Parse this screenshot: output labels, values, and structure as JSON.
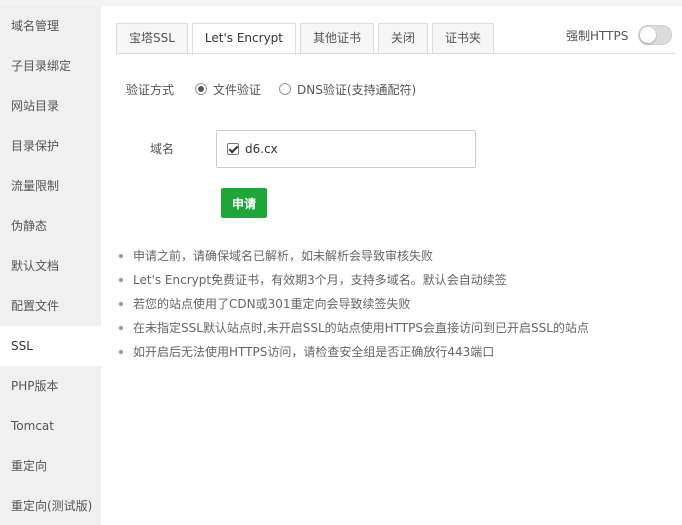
{
  "sidebar": {
    "items": [
      {
        "label": "域名管理"
      },
      {
        "label": "子目录绑定"
      },
      {
        "label": "网站目录"
      },
      {
        "label": "目录保护"
      },
      {
        "label": "流量限制"
      },
      {
        "label": "伪静态"
      },
      {
        "label": "默认文档"
      },
      {
        "label": "配置文件"
      },
      {
        "label": "SSL"
      },
      {
        "label": "PHP版本"
      },
      {
        "label": "Tomcat"
      },
      {
        "label": "重定向"
      },
      {
        "label": "重定向(测试版)"
      }
    ],
    "active_index": 8
  },
  "tabs": [
    {
      "label": "宝塔SSL"
    },
    {
      "label": "Let's Encrypt"
    },
    {
      "label": "其他证书"
    },
    {
      "label": "关闭"
    },
    {
      "label": "证书夹"
    }
  ],
  "active_tab": 1,
  "force_https": {
    "label": "强制HTTPS",
    "enabled": false
  },
  "form": {
    "method_label": "验证方式",
    "methods": [
      {
        "label": "文件验证",
        "checked": true
      },
      {
        "label": "DNS验证(支持通配符)",
        "checked": false
      }
    ],
    "domain_label": "域名",
    "domains": [
      {
        "label": "d6.cx",
        "checked": true
      }
    ],
    "apply_label": "申请"
  },
  "tips": [
    "申请之前，请确保域名已解析，如未解析会导致审核失败",
    "Let's Encrypt免费证书，有效期3个月，支持多域名。默认会自动续签",
    "若您的站点使用了CDN或301重定向会导致续签失败",
    "在未指定SSL默认站点时,未开启SSL的站点使用HTTPS会直接访问到已开启SSL的站点",
    "如开启后无法使用HTTPS访问，请检查安全组是否正确放行443端口"
  ],
  "colors": {
    "accent": "#20a53a",
    "sidebar_bg": "#f0f0f0",
    "border": "#dddddd"
  }
}
